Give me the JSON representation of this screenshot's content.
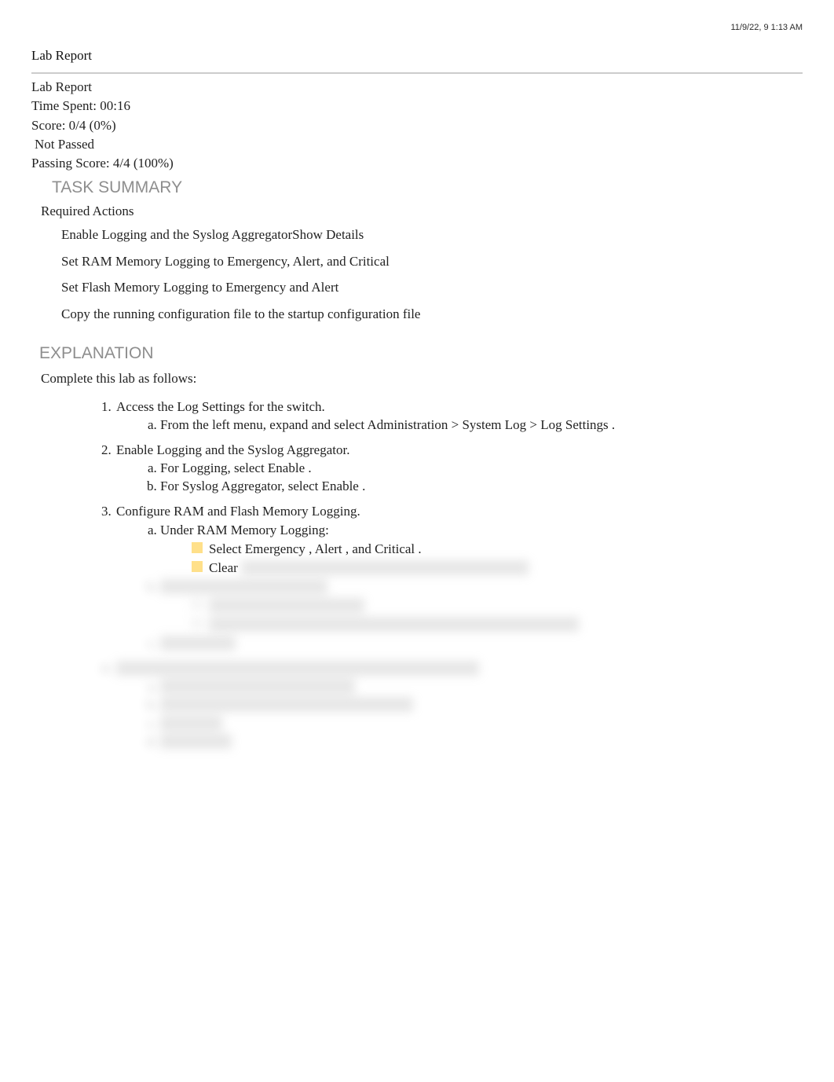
{
  "timestamp": "11/9/22, 9 1:13 AM",
  "page_title": "Lab Report",
  "meta": {
    "title": "Lab Report",
    "time_spent_label": "Time Spent: 00:16",
    "score_label": "Score: 0/4 (0%)",
    "status": "Not Passed",
    "passing_label": "Passing Score: 4/4 (100%)"
  },
  "sections": {
    "task_summary": "TASK SUMMARY",
    "required_actions": "Required Actions",
    "explanation": "EXPLANATION"
  },
  "actions": {
    "a1_text": "Enable Logging and the Syslog Aggregator",
    "a1_link": "Show Details",
    "a2": "Set RAM Memory Logging to Emergency, Alert, and Critical",
    "a3": "Set Flash Memory Logging to Emergency and Alert",
    "a4": "Copy the running configuration file to the startup configuration file"
  },
  "complete": "Complete this lab as follows:",
  "steps": {
    "s1": "Access  the Log Settings for the switch.",
    "s1a": "From the left menu, expand and select Administration   > System Log  > Log Settings .",
    "s2": "Enable Logging and the Syslog Aggregator.",
    "s2a": "For Logging, select Enable .",
    "s2b": "For Syslog Aggregator, select Enable .",
    "s3": "Configure RAM and Flash Memory Logging.",
    "s3a": "Under RAM Memory Logging:",
    "s3a_b1": "Select Emergency , Alert , and Critical  .",
    "s3a_b2_prefix": "Clear ",
    "s3a_b2_hidden": "Error , Warning , Notice , Informational  , and Debug .",
    "s3b": "Under Flash Memory Logging:",
    "s3b_b1": "Select Emergency  and Alert .",
    "s3b_b2": "Clear Critical , Error , Warning , Notice , Informational  , and Debug .",
    "s3c": "Select Apply .",
    "s4": "Copy the running configuration file to the startup configuration file.",
    "s4a": "From the top menu bar, select Save .",
    "s4b": "Under Copy/Save Configuration, select Apply .",
    "s4c": "Select OK .",
    "s4d": "Select Done ."
  }
}
